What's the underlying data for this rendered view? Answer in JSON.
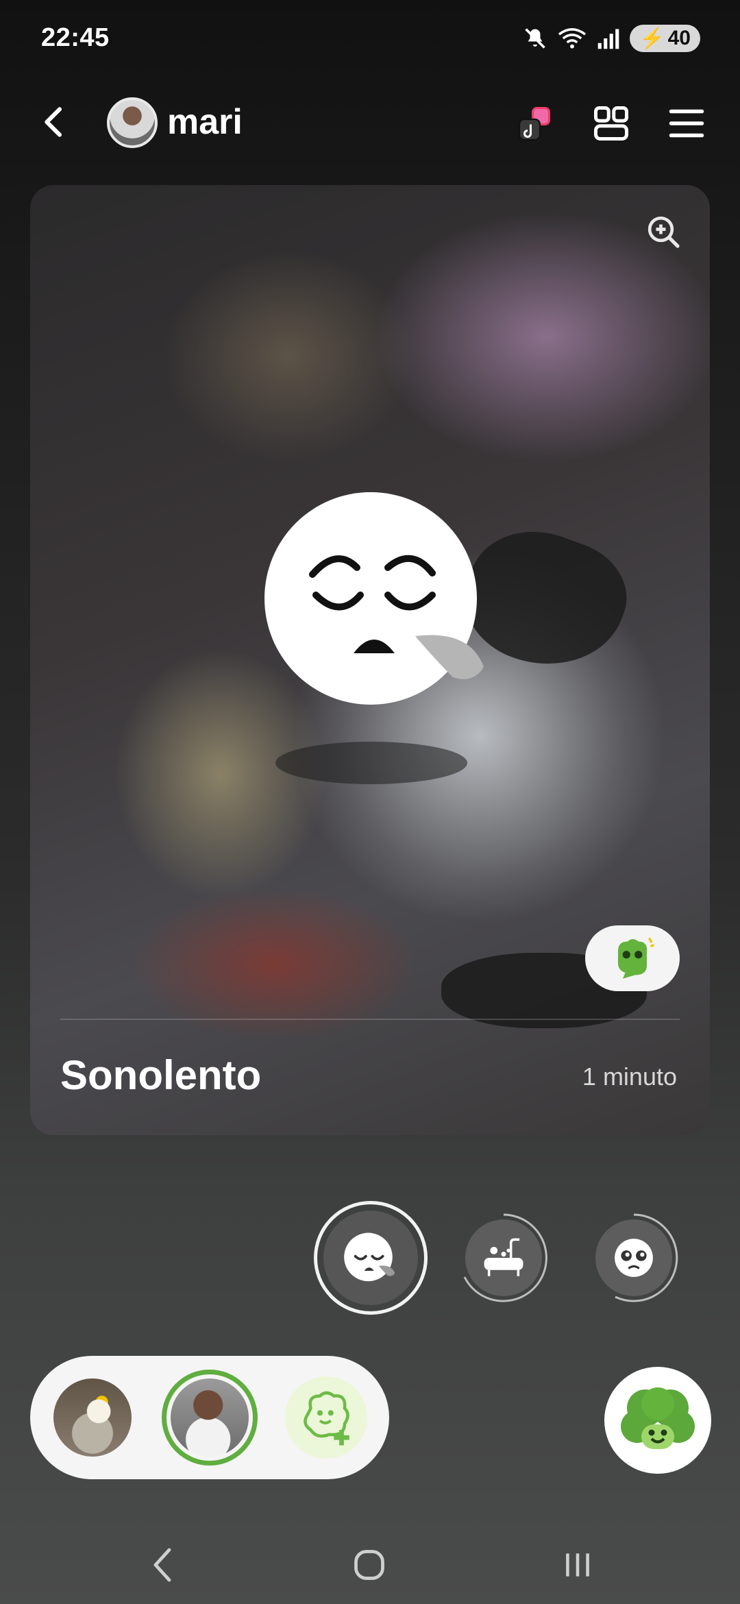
{
  "status_bar": {
    "time": "22:45",
    "battery": "40"
  },
  "header": {
    "title": "mari",
    "icons": [
      "back-arrow-icon",
      "tiktok-stack-icon",
      "grid-view-icon",
      "menu-icon"
    ]
  },
  "card": {
    "mood": "Sonolento",
    "time_ago": "1 minuto",
    "icons": [
      "zoom-in-icon",
      "sleepy-face-emoji",
      "mascot-sparkle-icon"
    ]
  },
  "mood_bubbles": [
    "sleepy-face-icon",
    "bathtub-icon",
    "pleading-face-icon"
  ],
  "friends": [
    "friend-avatar-bird",
    "friend-avatar-mari",
    "add-friend-icon"
  ],
  "nav": [
    "nav-back-icon",
    "nav-home-icon",
    "nav-recents-icon"
  ],
  "colors": {
    "accent_green": "#5fae3f",
    "mascot_green": "#63b33d"
  }
}
